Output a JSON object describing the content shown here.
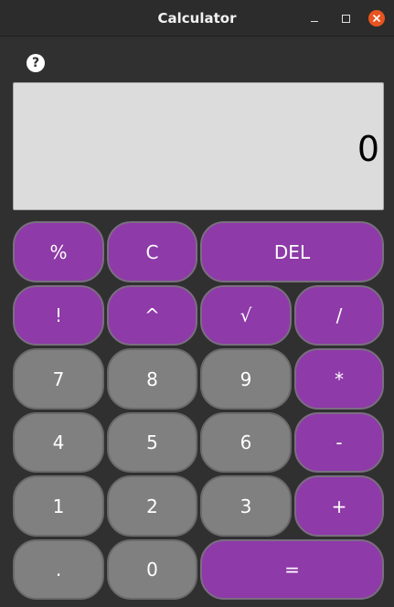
{
  "window": {
    "title": "Calculator",
    "minimize_icon": "minimize-icon",
    "maximize_icon": "maximize-icon",
    "close_icon": "close-icon"
  },
  "help": {
    "icon": "help-icon",
    "label": "?"
  },
  "display": {
    "value": "0"
  },
  "colors": {
    "operator": "#8e3aa8",
    "digit": "#808080",
    "close": "#e95420",
    "display_bg": "#dcdcdc"
  },
  "keys": {
    "percent": "%",
    "clear": "C",
    "delete": "DEL",
    "factorial": "!",
    "power": "^",
    "sqrt": "√",
    "divide": "/",
    "seven": "7",
    "eight": "8",
    "nine": "9",
    "multiply": "*",
    "four": "4",
    "five": "5",
    "six": "6",
    "minus": "-",
    "one": "1",
    "two": "2",
    "three": "3",
    "plus": "+",
    "decimal": ".",
    "zero": "0",
    "equals": "="
  }
}
